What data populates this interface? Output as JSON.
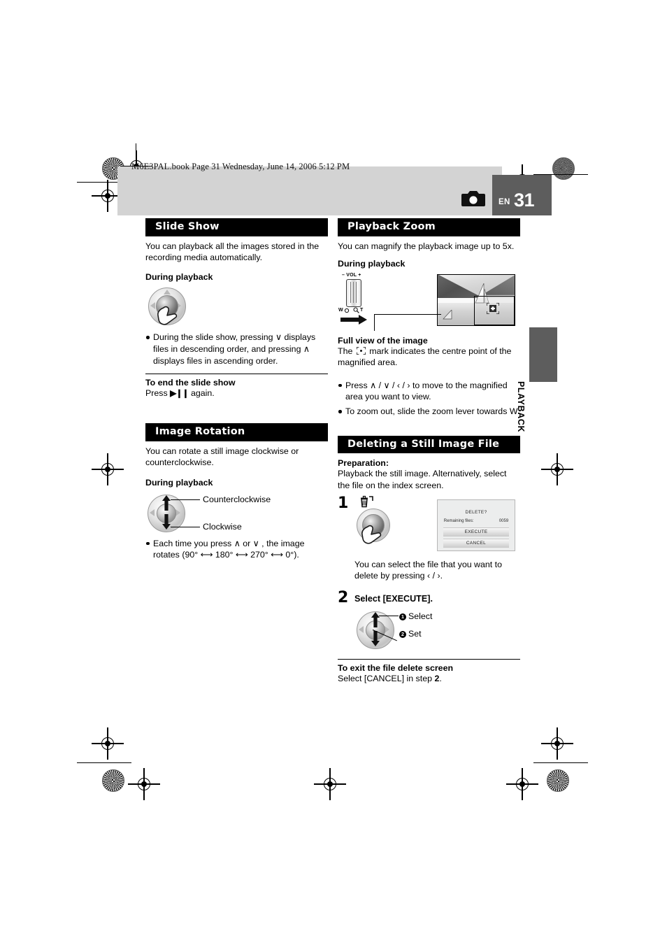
{
  "page": {
    "file_stamp": "M6E3PAL.book  Page 31  Wednesday, June 14, 2006  5:12 PM",
    "lang_code": "EN",
    "page_number": "31",
    "side_tab_label": "PLAYBACK",
    "camera_icon": "still-camera-icon"
  },
  "left_column": {
    "slide_show": {
      "heading": "Slide Show",
      "intro": "You can playback all the images stored in the recording media automatically.",
      "during_playback": "During playback",
      "joystick_icon": "joystick-press-icon",
      "bullet": "During the slide show, pressing ∨ displays files in descending order, and pressing ∧ displays files in ascending order.",
      "end_heading": "To end the slide show",
      "end_text_before": "Press",
      "end_text_glyph": "▶❙❙",
      "end_text_after": "again."
    },
    "image_rotation": {
      "heading": "Image Rotation",
      "intro": "You can rotate a still image clockwise or counterclockwise.",
      "during_playback": "During playback",
      "joystick_icon": "joystick-updown-icon",
      "label_ccw": "Counterclockwise",
      "label_cw": "Clockwise",
      "bullet": "Each time you press ∧ or ∨ , the image rotates (90° ⟷ 180° ⟷ 270° ⟷ 0°)."
    }
  },
  "right_column": {
    "playback_zoom": {
      "heading": "Playback Zoom",
      "intro": "You can magnify the playback image up to 5x.",
      "during_playback": "During playback",
      "lever": {
        "icon": "zoom-lever-icon",
        "top_label": "– VOL +",
        "w_label": "W",
        "t_label": "T",
        "wide_icon": "wide-angle-icon",
        "tele_icon": "magnifier-icon",
        "arrow_icon": "right-arrow-icon"
      },
      "photo_icon": "sailboat-photo-thumbnail",
      "centre_mark_icon": "centre-point-mark-icon",
      "full_view_heading": "Full view of the image",
      "full_view_text_before": "The",
      "full_view_text_after": "mark indicates the centre point of the magnified area.",
      "bullet_1_before": "Press",
      "bullet_1_glyphs": "∧ / ∨ / ‹ / ›",
      "bullet_1_after": "to move to the magnified area you want to view.",
      "bullet_2": "To zoom out, slide the zoom lever towards W."
    },
    "deleting_file": {
      "heading": "Deleting a Still Image File",
      "preparation_label": "Preparation:",
      "preparation_text": "Playback the still image. Alternatively, select the file on the index screen.",
      "step1": {
        "number": "1",
        "trash_icon": "trash-can-icon",
        "joystick_icon": "joystick-press-icon",
        "caption_before": "You can select the file that you want to delete by pressing",
        "caption_glyphs": "‹ / ›",
        "caption_after": "."
      },
      "dialog": {
        "title": "DELETE?",
        "remaining_label": "Remaining files:",
        "remaining_value": "0059",
        "execute_button": "EXECUTE",
        "cancel_button": "CANCEL"
      },
      "step2": {
        "number": "2",
        "title": "Select [EXECUTE].",
        "joystick_icon": "joystick-select-set-icon",
        "badge_1": "❶",
        "label_select": "Select",
        "badge_2": "❷",
        "label_set": "Set"
      },
      "exit_heading": "To exit the file delete screen",
      "exit_text_before": "Select [CANCEL] in step",
      "exit_text_step": "2",
      "exit_text_after": "."
    }
  },
  "colors": {
    "header_band": "#d3d3d3",
    "page_box": "#5d5d5d",
    "section_heading_bg": "#000000"
  }
}
